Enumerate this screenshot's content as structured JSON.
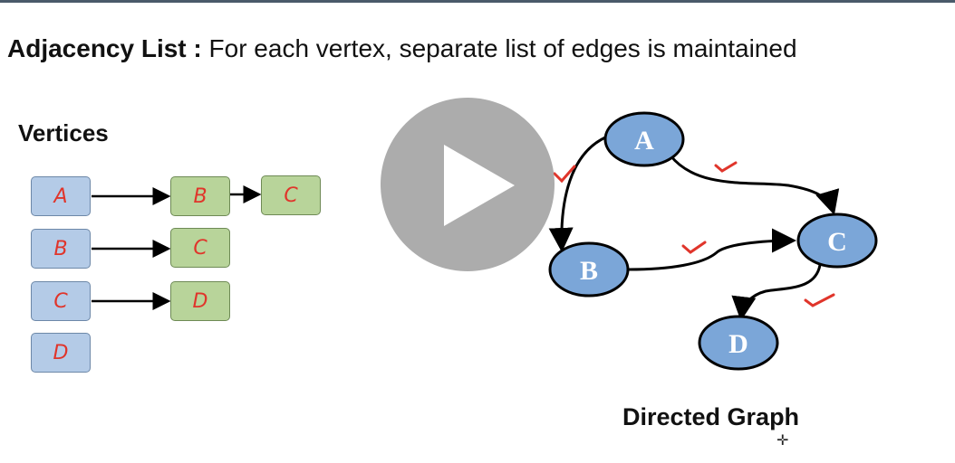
{
  "heading": {
    "term": "Adjacency List :",
    "definition": " For each vertex, separate list of edges is maintained"
  },
  "vertices_title": "Vertices",
  "adjacency": [
    {
      "vertex": "A",
      "edges": [
        "B",
        "C"
      ]
    },
    {
      "vertex": "B",
      "edges": [
        "C"
      ]
    },
    {
      "vertex": "C",
      "edges": [
        "D"
      ]
    },
    {
      "vertex": "D",
      "edges": []
    }
  ],
  "graph": {
    "nodes": [
      "A",
      "B",
      "C",
      "D"
    ],
    "edges": [
      [
        "A",
        "B"
      ],
      [
        "A",
        "C"
      ],
      [
        "B",
        "C"
      ],
      [
        "C",
        "D"
      ]
    ],
    "title": "Directed Graph",
    "node_color": "#7ba6d8",
    "check_color": "#e0352b"
  },
  "video": {
    "play_icon": "play-icon"
  }
}
